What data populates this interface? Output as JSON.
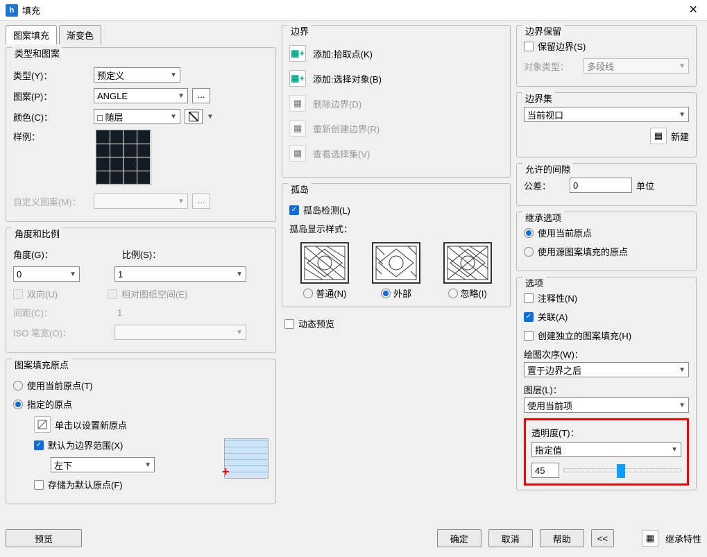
{
  "title": "填充",
  "tabs": {
    "hatch": "图案填充",
    "gradient": "渐变色"
  },
  "typePattern": {
    "legend": "类型和图案",
    "typeLabel": "类型(Y)：",
    "typeValue": "预定义",
    "patternLabel": "图案(P)：",
    "patternValue": "ANGLE",
    "colorLabel": "颜色(C)：",
    "colorValue": "随层",
    "sampleLabel": "样例：",
    "customLabel": "自定义图案(M)："
  },
  "angleScale": {
    "legend": "角度和比例",
    "angleLabel": "角度(G)：",
    "angleValue": "0",
    "scaleLabel": "比例(S)：",
    "scaleValue": "1",
    "doubleLabel": "双向(U)",
    "relative": "相对图纸空间(E)",
    "spacingLabel": "间距(C)：",
    "spacingValue": "1",
    "isoLabel": "ISO 笔宽(O)："
  },
  "origin": {
    "legend": "图案填充原点",
    "useCurrent": "使用当前原点(T)",
    "specified": "指定的原点",
    "clickNew": "单击以设置新原点",
    "defaultExtent": "默认为边界范围(X)",
    "extentValue": "左下",
    "store": "存储为默认原点(F)"
  },
  "boundary": {
    "legend": "边界",
    "addPick": "添加:拾取点(K)",
    "addSelect": "添加:选择对象(B)",
    "remove": "删除边界(D)",
    "recreate": "重新创建边界(R)",
    "viewSel": "查看选择集(V)"
  },
  "islands": {
    "legend": "孤岛",
    "detect": "孤岛检测(L)",
    "styleLabel": "孤岛显示样式：",
    "normal": "普通(N)",
    "outer": "外部",
    "ignore": "忽略(I)"
  },
  "dynamicPreview": "动态预览",
  "retain": {
    "legend": "边界保留",
    "keep": "保留边界(S)",
    "objTypeLabel": "对象类型：",
    "objTypeValue": "多段线"
  },
  "bset": {
    "legend": "边界集",
    "value": "当前视口",
    "new": "新建"
  },
  "gap": {
    "legend": "允许的间隙",
    "tolLabel": "公差：",
    "tolValue": "0",
    "unit": "单位"
  },
  "inherit": {
    "legend": "继承选项",
    "current": "使用当前原点",
    "source": "使用源图案填充的原点"
  },
  "options": {
    "legend": "选项",
    "annotative": "注释性(N)",
    "associative": "关联(A)",
    "separate": "创建独立的图案填充(H)",
    "drawOrderLabel": "绘图次序(W)：",
    "drawOrderValue": "置于边界之后",
    "layerLabel": "图层(L)：",
    "layerValue": "使用当前项",
    "transLabel": "透明度(T)：",
    "transMode": "指定值",
    "transValue": "45"
  },
  "buttons": {
    "preview": "预览",
    "ok": "确定",
    "cancel": "取消",
    "help": "帮助",
    "inheritProps": "继承特性"
  }
}
